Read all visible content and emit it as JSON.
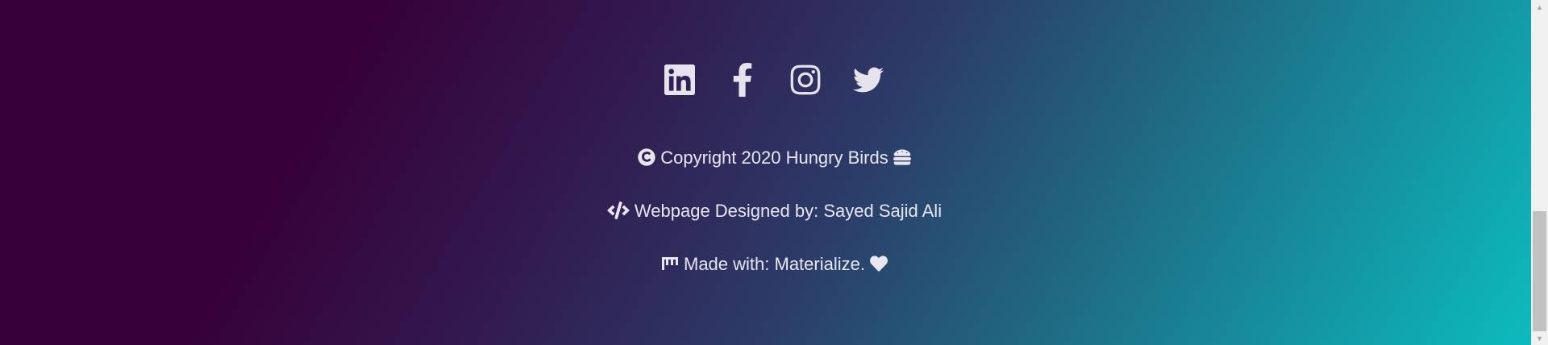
{
  "social": {
    "icons": [
      "linkedin-icon",
      "facebook-icon",
      "instagram-icon",
      "twitter-icon"
    ]
  },
  "footer": {
    "copyright": "Copyright 2020 Hungry Birds",
    "designer": "Webpage Designed by: Sayed Sajid Ali",
    "made_with": "Made with: Materialize."
  },
  "colors": {
    "gradient_start": "#37003a",
    "gradient_mid": "#2c3b68",
    "gradient_end": "#0cbbbd",
    "text": "#e9e6f1"
  }
}
